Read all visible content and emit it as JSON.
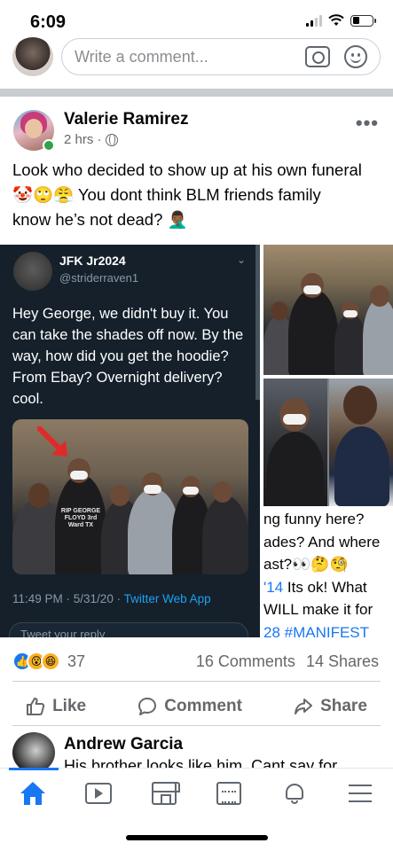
{
  "status_bar": {
    "time": "6:09"
  },
  "composer": {
    "placeholder": "Write a comment..."
  },
  "post": {
    "author": "Valerie Ramirez",
    "time": "2 hrs ·",
    "text_line1": "Look who decided to show up at his own funeral",
    "text_line2": "🤡🙄😤 You dont think BLM friends family",
    "text_line3": "know he’s not dead? 🤦🏾‍♂️",
    "reaction_count": "37",
    "comments": "16 Comments",
    "shares": "14 Shares"
  },
  "tweet": {
    "name": "JFK Jr2024",
    "handle": "@striderraven1",
    "text": "Hey George, we didn't buy it. You can take the shades off now. By the way, how did you get the hoodie? From Ebay? Overnight delivery? cool.",
    "time": "11:49 PM · 5/31/20 · ",
    "source": "Twitter Web App",
    "reply_placeholder": "Tweet your reply",
    "hoodie_text": "RIP GEORGE FLOYD 3rd Ward TX"
  },
  "caption_lines": [
    "ng funny here?",
    "ades? And where",
    "ast?👀🤔🧐",
    "'14 Its ok! What",
    "WILL make it for",
    "28 #MANIFEST"
  ],
  "actions": {
    "like": "Like",
    "comment": "Comment",
    "share": "Share"
  },
  "comment": {
    "author": "Andrew Garcia",
    "text": "His brother looks like him. Cant say for"
  },
  "colors": {
    "accent": "#1877f2",
    "online": "#31a24c",
    "tweet_bg": "#15202b"
  }
}
